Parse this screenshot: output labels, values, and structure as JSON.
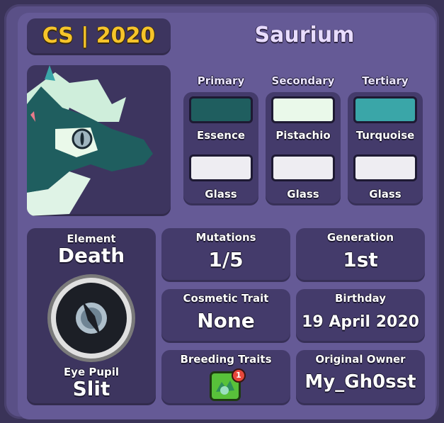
{
  "header": {
    "tag": "CS | 2020",
    "species": "Saurium"
  },
  "colors": {
    "columns": [
      {
        "heading": "Primary",
        "color_name": "Essence",
        "color_hex": "#1f5e5f",
        "material": "Glass",
        "material_hex": "#eeedf2"
      },
      {
        "heading": "Secondary",
        "color_name": "Pistachio",
        "color_hex": "#eaf9ea",
        "material": "Glass",
        "material_hex": "#eeedf2"
      },
      {
        "heading": "Tertiary",
        "color_name": "Turquoise",
        "color_hex": "#3aa6a8",
        "material": "Glass",
        "material_hex": "#eeedf2"
      }
    ]
  },
  "element": {
    "label": "Element",
    "value": "Death"
  },
  "eye": {
    "label": "Eye Pupil",
    "value": "Slit"
  },
  "stats": {
    "mutations": {
      "label": "Mutations",
      "value": "1/5"
    },
    "generation": {
      "label": "Generation",
      "value": "1st"
    },
    "cosmetic": {
      "label": "Cosmetic Trait",
      "value": "None"
    },
    "birthday": {
      "label": "Birthday",
      "value": "19 April 2020"
    },
    "breeding": {
      "label": "Breeding Traits",
      "badge": "1"
    },
    "owner": {
      "label": "Original Owner",
      "value": "My_Gh0sst"
    }
  },
  "accent": {
    "gold": "#f6c42a",
    "lavender": "#e8dcff"
  }
}
